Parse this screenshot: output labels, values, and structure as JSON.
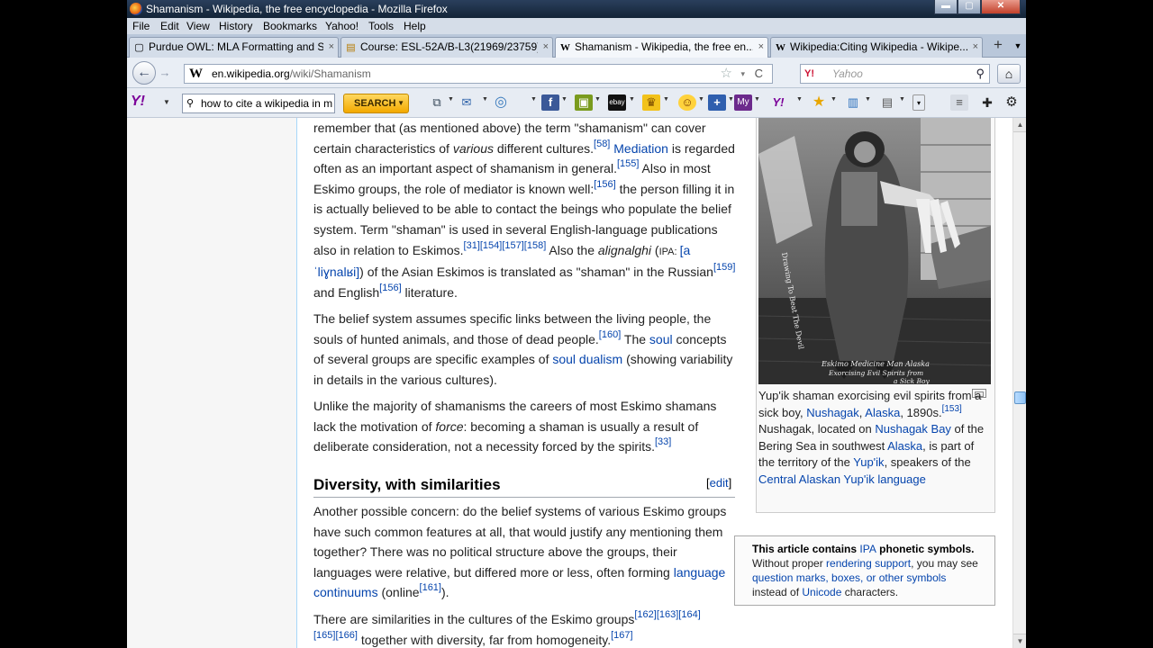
{
  "window": {
    "title": "Shamanism - Wikipedia, the free encyclopedia - Mozilla Firefox",
    "controls": {
      "minimize": "▬",
      "maximize": "▢",
      "close": "✕"
    }
  },
  "menu": [
    "File",
    "Edit",
    "View",
    "History",
    "Bookmarks",
    "Yahoo!",
    "Tools",
    "Help"
  ],
  "tabs": [
    {
      "label": "Purdue OWL: MLA Formatting and S...",
      "icon": "▢",
      "active": false
    },
    {
      "label": "Course: ESL-52A/B-L3(21969/23759)...",
      "icon": "▤",
      "active": false
    },
    {
      "label": "Shamanism - Wikipedia, the free en...",
      "icon": "W",
      "active": true
    },
    {
      "label": "Wikipedia:Citing Wikipedia - Wikipe...",
      "icon": "W",
      "active": false
    }
  ],
  "tab_close": "×",
  "new_tab": "+",
  "tab_list": "▼",
  "nav": {
    "back": "←",
    "forward": "→",
    "url_host": "en.wikipedia.org",
    "url_path": "/wiki/Shamanism",
    "site_icon": "W",
    "star": "☆",
    "reload": "C",
    "dropdown": "▾",
    "search_engine": "Y!",
    "search_placeholder": "Yahoo",
    "search_icon": "⚲",
    "home_icon": "⌂"
  },
  "yahoo_toolbar": {
    "logo": "Y!",
    "search_value": "how to cite a wikipedia in m",
    "search_button": "SEARCH",
    "caret": "▼",
    "icons": [
      "⧉",
      "✉",
      "◎",
      "f",
      "▣",
      "ebay",
      "♛",
      "☺",
      "+",
      "My",
      "Y!",
      "★",
      "▥",
      "▤",
      "▾"
    ],
    "right_icons": [
      "≡",
      "✚",
      "⚙"
    ]
  },
  "article": {
    "para1": {
      "t1": "remember that (as mentioned above) the term \"shamanism\" can cover certain characteristics of ",
      "i1": "various",
      "t2": " different cultures.",
      "s1": "[58]",
      "a1": "Mediation",
      "t3": " is regarded often as an important aspect of shamanism in general.",
      "s2": "[155]",
      "t4": " Also in most Eskimo groups, the role of mediator is known well:",
      "s3": "[156]",
      "t5": " the person filling it in is actually believed to be able to contact the beings who populate the belief system. Term \"shaman\" is used in several English-language publications also in relation to Eskimos.",
      "s4": "[31][154][157][158]",
      "t6": " Also the ",
      "i2": "alignalghi",
      "t7": " (",
      "ipa_label": "IPA: ",
      "ipa": "[aˈliɣnalʁi]",
      "t8": ") of the Asian Eskimos is translated as \"shaman\" in the Russian",
      "s5": "[159]",
      "t9": " and English",
      "s6": "[156]",
      "t10": " literature."
    },
    "para2": {
      "t1": "The belief system assumes specific links between the living people, the souls of hunted animals, and those of dead people.",
      "s1": "[160]",
      "t2": " The ",
      "a1": "soul",
      "t3": " concepts of several groups are specific examples of ",
      "a2": "soul dualism",
      "t4": " (showing variability in details in the various cultures)."
    },
    "para3": {
      "t1": "Unlike the majority of shamanisms the careers of most Eskimo shamans lack the motivation of ",
      "i1": "force",
      "t2": ": becoming a shaman is usually a result of deliberate consideration, not a necessity forced by the spirits.",
      "s1": "[33]"
    },
    "heading": "Diversity, with similarities",
    "edit_open": "[",
    "edit_link": "edit",
    "edit_close": "]",
    "para4": {
      "t1": "Another possible concern: do the belief systems of various Eskimo groups have such common features at all, that would justify any mentioning them together? There was no political structure above the groups, their languages were relative, but differed more or less, often forming ",
      "a1": "language continuums",
      "t2": " (online",
      "s1": "[161]",
      "t3": ")."
    },
    "para5": {
      "t1": "There are similarities in the cultures of the Eskimo groups",
      "s1": "[162][163][164]",
      "s2": "[165][166]",
      "t2": " together with diversity, far from homogeneity.",
      "s3": "[167]"
    }
  },
  "thumb": {
    "caption_t1": "Yup'ik shaman exorcising evil spirits from a sick boy, ",
    "caption_a1": "Nushagak",
    "caption_t2": ", ",
    "caption_a2": "Alaska",
    "caption_t3": ", 1890s.",
    "caption_s1": "[153]",
    "caption_t4": " Nushagak, located on ",
    "caption_a3": "Nushagak Bay",
    "caption_t5": " of the Bering Sea in southwest ",
    "caption_a4": "Alaska",
    "caption_t6": ", is part of the territory of the ",
    "caption_a5": "Yup'ik",
    "caption_t7": ", speakers of the ",
    "caption_a6": "Central Alaskan Yup'ik language",
    "photo_text_left": "Drawing To Beat The Devil",
    "photo_text_bottom1": "Eskimo Medicine Man Alaska",
    "photo_text_bottom2": "Exorcising Evil Spirits from",
    "photo_text_bottom3": "a Sick Boy"
  },
  "ipabox": {
    "b1": "This article contains ",
    "a1": "IPA",
    "b2": " phonetic symbols.",
    "t1": " Without proper ",
    "a2": "rendering support",
    "t2": ", you may see ",
    "a3": "question marks, boxes, or other symbols",
    "t3": " instead of ",
    "a4": "Unicode",
    "t4": " characters."
  },
  "scrollbar": {
    "up": "▲",
    "down": "▼"
  }
}
